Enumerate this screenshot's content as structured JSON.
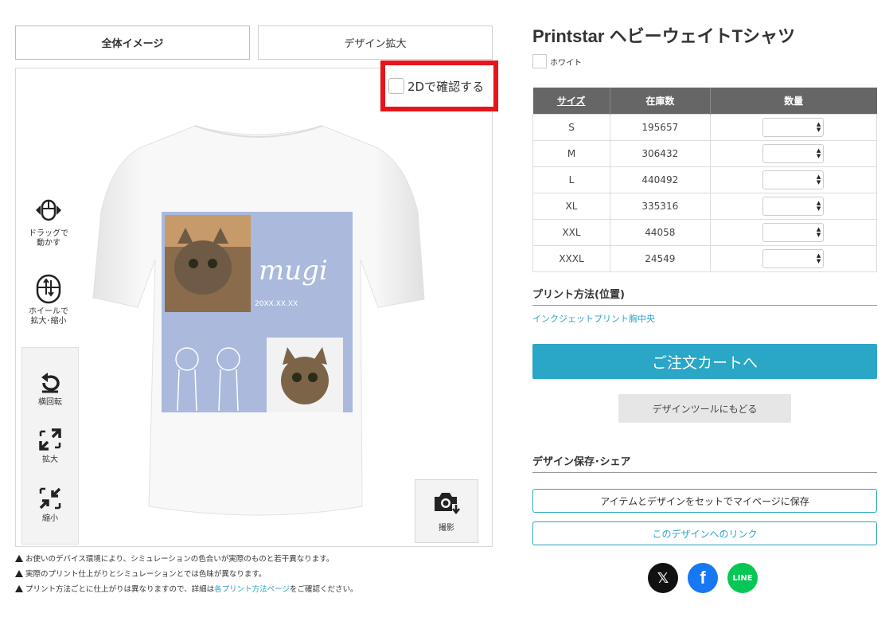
{
  "tabs": {
    "whole": "全体イメージ",
    "zoom": "デザイン拡大"
  },
  "preview": {
    "check2d_label": "2Dで確認する",
    "design_text": "mugi",
    "design_date": "20XX.XX.XX",
    "tools": {
      "drag": "ドラッグで\n動かす",
      "wheel": "ホイールで\n拡大･縮小",
      "rotate": "横回転",
      "zoom_in": "拡大",
      "zoom_out": "縮小",
      "shot": "撮影"
    }
  },
  "notes": {
    "line1": "お使いのデバイス環境により、シミュレーションの色合いが実際のものと若干異なります。",
    "line2": "実際のプリント仕上がりとシミュレーションとでは色味が異なります。",
    "line3_pre": "プリント方法ごとに仕上がりは異なりますので、詳細は",
    "line3_link": "各プリント方法ページ",
    "line3_post": "をご確認ください。"
  },
  "product": {
    "title": "Printstar ヘビーウェイトTシャツ",
    "color": "ホワイト"
  },
  "size_table": {
    "headers": [
      "サイズ",
      "在庫数",
      "数量"
    ],
    "rows": [
      {
        "size": "S",
        "stock": "195657"
      },
      {
        "size": "M",
        "stock": "306432"
      },
      {
        "size": "L",
        "stock": "440492"
      },
      {
        "size": "XL",
        "stock": "335316"
      },
      {
        "size": "XXL",
        "stock": "44058"
      },
      {
        "size": "XXXL",
        "stock": "24549"
      }
    ]
  },
  "print_method": {
    "heading": "プリント方法(位置)",
    "value": "インクジェットプリント胸中央"
  },
  "buttons": {
    "order": "ご注文カートへ",
    "back": "デザインツールにもどる",
    "save": "アイテムとデザインをセットでマイページに保存",
    "link": "このデザインへのリンク"
  },
  "share": {
    "heading": "デザイン保存･シェア",
    "x": "𝕏",
    "facebook": "f",
    "line": "LINE"
  },
  "colors": {
    "accent": "#2aa6c6",
    "highlight": "#e8141b",
    "design_bg": "#aab9dc"
  }
}
